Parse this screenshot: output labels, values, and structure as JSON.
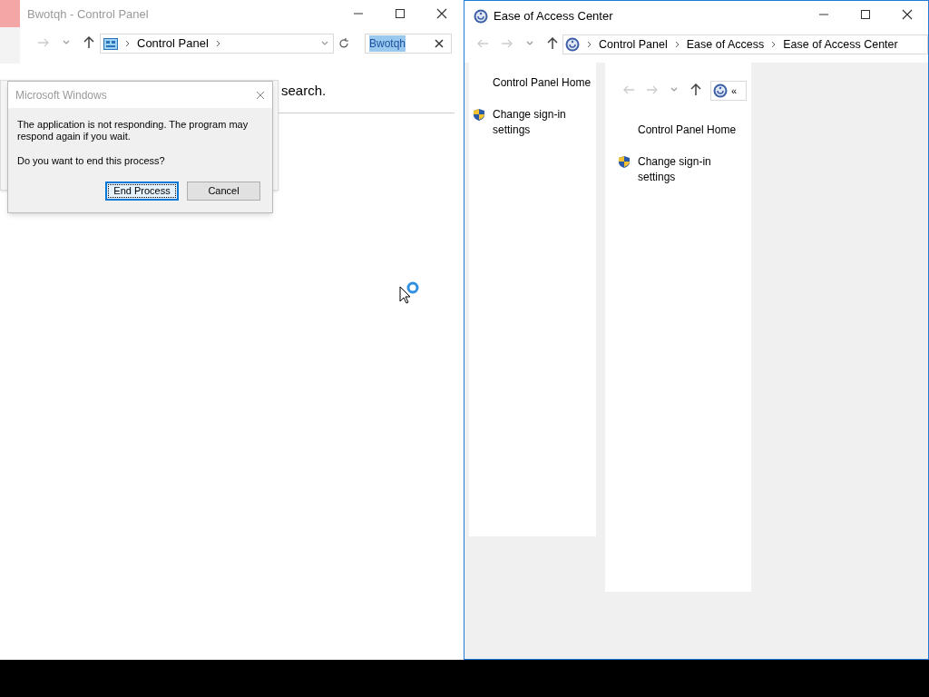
{
  "left_window": {
    "title": "Bwotqh - Control Panel",
    "address": [
      "Control Panel"
    ],
    "search": {
      "value": "Bwotqh",
      "selected": true
    },
    "body_text": "search."
  },
  "dialog": {
    "title": "Microsoft Windows",
    "message": "The application is not responding. The program may respond again if you wait.",
    "question": "Do you want to end this process?",
    "buttons": [
      {
        "label": "End Process",
        "focused": true
      },
      {
        "label": "Cancel",
        "focused": false
      }
    ]
  },
  "right_window": {
    "title": "Ease of Access Center",
    "address": [
      "Control Panel",
      "Ease of Access",
      "Ease of Access Center"
    ],
    "sidebar": [
      {
        "kind": "link",
        "label": "Control Panel Home"
      },
      {
        "kind": "admin",
        "label": "Change sign-in settings"
      }
    ],
    "inner_panel": {
      "address_more": "«",
      "sidebar": [
        {
          "kind": "link",
          "label": "Control Panel Home"
        },
        {
          "kind": "admin",
          "label": "Change sign-in settings"
        }
      ]
    }
  }
}
